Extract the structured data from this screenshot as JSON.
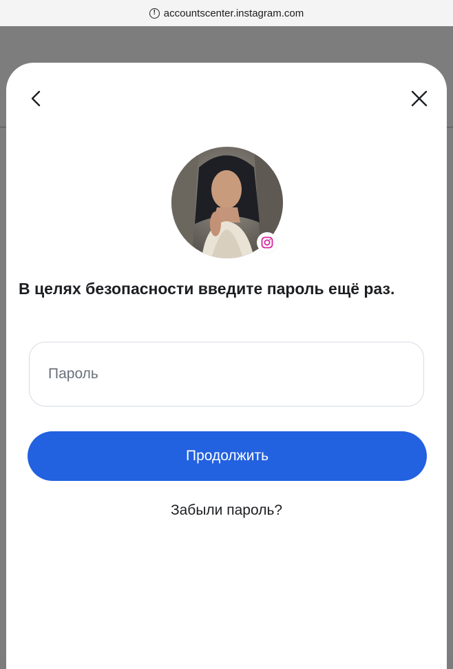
{
  "browser": {
    "url": "accountscenter.instagram.com"
  },
  "dialog": {
    "title": "В целях безопасности введите пароль ещё раз.",
    "password_placeholder": "Пароль",
    "password_value": "",
    "continue_label": "Продолжить",
    "forgot_label": "Забыли пароль?"
  },
  "colors": {
    "primary_button": "#2261df",
    "instagram_badge": "#d6249f"
  },
  "icons": {
    "back": "chevron-left-icon",
    "close": "close-icon",
    "badge": "instagram-icon",
    "url_info": "info-circle-icon"
  }
}
